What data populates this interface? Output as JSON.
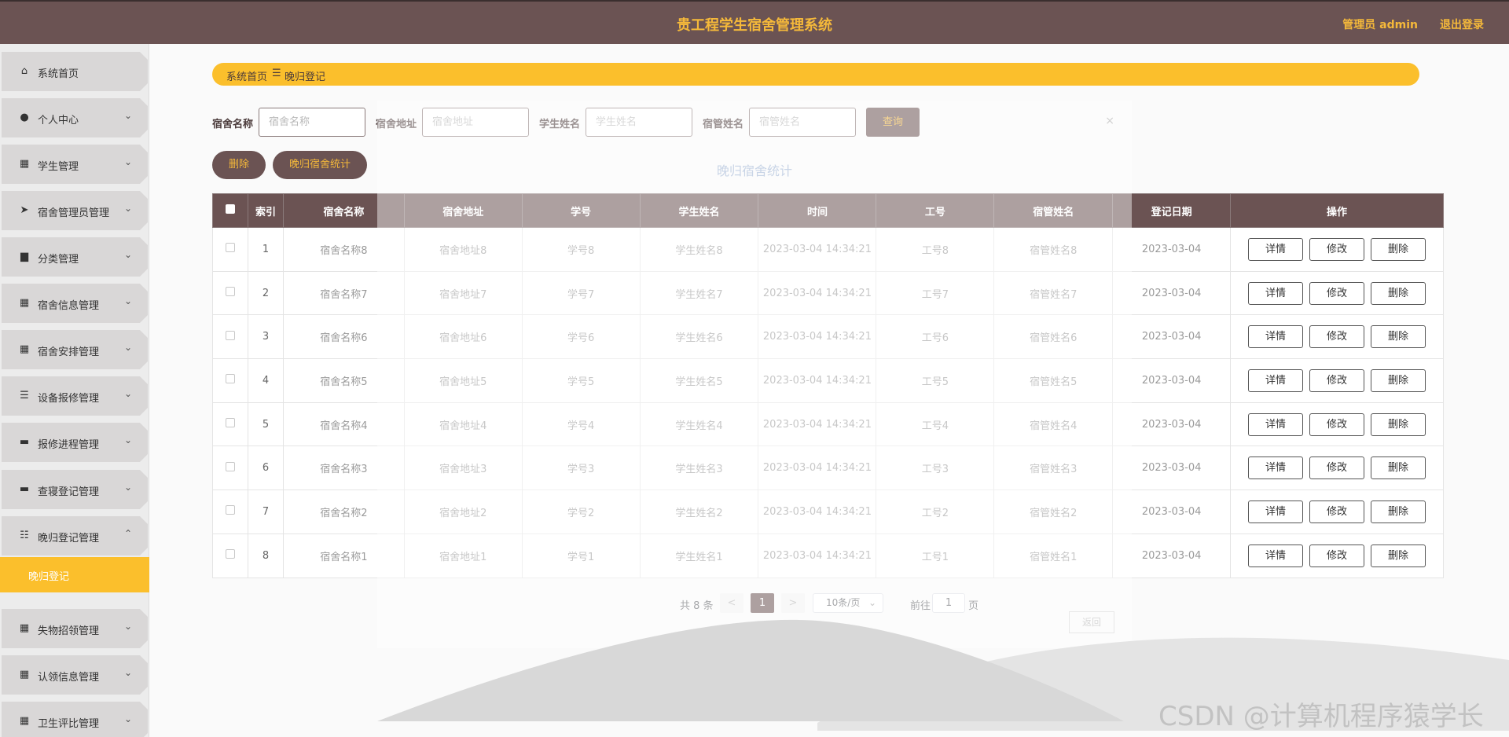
{
  "header": {
    "title": "贵工程学生宿舍管理系统",
    "user": "管理员 admin",
    "logout": "退出登录"
  },
  "sidebar": {
    "items": [
      {
        "label": "系统首页",
        "icon": "home-icon",
        "glyph": "⌂",
        "chevron": ""
      },
      {
        "label": "个人中心",
        "icon": "user-icon",
        "glyph": "●",
        "chevron": "⌄"
      },
      {
        "label": "学生管理",
        "icon": "grid-icon",
        "glyph": "▦",
        "chevron": "⌄"
      },
      {
        "label": "宿舍管理员管理",
        "icon": "send-icon",
        "glyph": "➤",
        "chevron": "⌄"
      },
      {
        "label": "分类管理",
        "icon": "box-icon",
        "glyph": "▆",
        "chevron": "⌄"
      },
      {
        "label": "宿舍信息管理",
        "icon": "grid-icon",
        "glyph": "▦",
        "chevron": "⌄"
      },
      {
        "label": "宿舍安排管理",
        "icon": "grid-icon",
        "glyph": "▦",
        "chevron": "⌄"
      },
      {
        "label": "设备报修管理",
        "icon": "list-icon",
        "glyph": "☰",
        "chevron": "⌄"
      },
      {
        "label": "报修进程管理",
        "icon": "flag-icon",
        "glyph": "▬",
        "chevron": "⌄"
      },
      {
        "label": "查寝登记管理",
        "icon": "doc-icon",
        "glyph": "▬",
        "chevron": "⌄"
      },
      {
        "label": "晚归登记管理",
        "icon": "sliders-icon",
        "glyph": "☷",
        "chevron": "⌃"
      },
      {
        "label": "失物招领管理",
        "icon": "grid-icon",
        "glyph": "▦",
        "chevron": "⌄"
      },
      {
        "label": "认领信息管理",
        "icon": "grid-icon",
        "glyph": "▦",
        "chevron": "⌄"
      },
      {
        "label": "卫生评比管理",
        "icon": "grid-icon",
        "glyph": "▦",
        "chevron": "⌄"
      }
    ],
    "sub_active": "晚归登记"
  },
  "breadcrumb": {
    "home": "系统首页",
    "sep": "☰",
    "current": "晚归登记"
  },
  "search": {
    "fields": [
      {
        "label": "宿舍名称",
        "placeholder": "宿舍名称"
      },
      {
        "label": "宿舍地址",
        "placeholder": "宿舍地址"
      },
      {
        "label": "学生姓名",
        "placeholder": "学生姓名"
      },
      {
        "label": "宿管姓名",
        "placeholder": "宿管姓名"
      }
    ],
    "query_label": "查询"
  },
  "actions": {
    "delete_label": "删除",
    "stats_label": "晚归宿舍统计"
  },
  "table": {
    "columns": [
      "索引",
      "宿舍名称",
      "宿舍地址",
      "学号",
      "学生姓名",
      "时间",
      "工号",
      "宿管姓名",
      "登记日期",
      "操作"
    ],
    "ops": [
      "详情",
      "修改",
      "删除"
    ],
    "rows": [
      {
        "idx": "1",
        "name": "宿舍名称8",
        "addr": "宿舍地址8",
        "sid": "学号8",
        "sname": "学生姓名8",
        "time": "2023-03-04 14:34:21",
        "wid": "工号8",
        "mname": "宿管姓名8",
        "date": "2023-03-04"
      },
      {
        "idx": "2",
        "name": "宿舍名称7",
        "addr": "宿舍地址7",
        "sid": "学号7",
        "sname": "学生姓名7",
        "time": "2023-03-04 14:34:21",
        "wid": "工号7",
        "mname": "宿管姓名7",
        "date": "2023-03-04"
      },
      {
        "idx": "3",
        "name": "宿舍名称6",
        "addr": "宿舍地址6",
        "sid": "学号6",
        "sname": "学生姓名6",
        "time": "2023-03-04 14:34:21",
        "wid": "工号6",
        "mname": "宿管姓名6",
        "date": "2023-03-04"
      },
      {
        "idx": "4",
        "name": "宿舍名称5",
        "addr": "宿舍地址5",
        "sid": "学号5",
        "sname": "学生姓名5",
        "time": "2023-03-04 14:34:21",
        "wid": "工号5",
        "mname": "宿管姓名5",
        "date": "2023-03-04"
      },
      {
        "idx": "5",
        "name": "宿舍名称4",
        "addr": "宿舍地址4",
        "sid": "学号4",
        "sname": "学生姓名4",
        "time": "2023-03-04 14:34:21",
        "wid": "工号4",
        "mname": "宿管姓名4",
        "date": "2023-03-04"
      },
      {
        "idx": "6",
        "name": "宿舍名称3",
        "addr": "宿舍地址3",
        "sid": "学号3",
        "sname": "学生姓名3",
        "time": "2023-03-04 14:34:21",
        "wid": "工号3",
        "mname": "宿管姓名3",
        "date": "2023-03-04"
      },
      {
        "idx": "7",
        "name": "宿舍名称2",
        "addr": "宿舍地址2",
        "sid": "学号2",
        "sname": "学生姓名2",
        "time": "2023-03-04 14:34:21",
        "wid": "工号2",
        "mname": "宿管姓名2",
        "date": "2023-03-04"
      },
      {
        "idx": "8",
        "name": "宿舍名称1",
        "addr": "宿舍地址1",
        "sid": "学号1",
        "sname": "学生姓名1",
        "time": "2023-03-04 14:34:21",
        "wid": "工号1",
        "mname": "宿管姓名1",
        "date": "2023-03-04"
      }
    ]
  },
  "pagination": {
    "total": "共 8 条",
    "prev": "<",
    "current": "1",
    "next": ">",
    "page_size": "10条/页",
    "goto": "前往",
    "goto_value": "1",
    "page_suffix": "页"
  },
  "dialog": {
    "title": "晚归宿舍统计",
    "close": "×",
    "back": "返回"
  },
  "watermark": "CSDN @计算机程序猿学长",
  "colors": {
    "header": "#6b5353",
    "accent": "#fbbf2c",
    "accent_text": "#f5b93a"
  }
}
